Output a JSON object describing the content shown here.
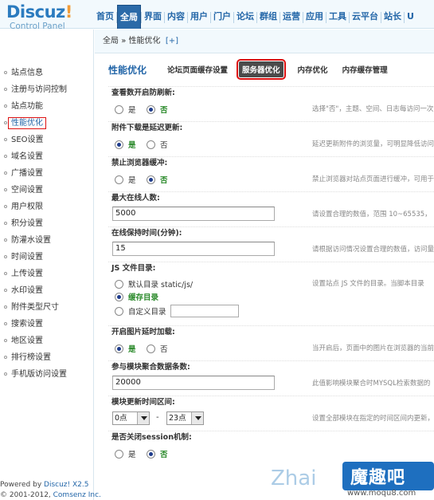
{
  "logo": {
    "main": "Discuz",
    "bang": "!",
    "sub": "Control Panel"
  },
  "topnav": [
    "首页",
    "全局",
    "界面",
    "内容",
    "用户",
    "门户",
    "论坛",
    "群组",
    "运营",
    "应用",
    "工具",
    "云平台",
    "站长",
    "U"
  ],
  "topnav_active": 1,
  "breadcrumb": {
    "section": "全局",
    "sep": "»",
    "page": "性能优化",
    "add": "[+]"
  },
  "sidebar": {
    "items": [
      "站点信息",
      "注册与访问控制",
      "站点功能",
      "性能优化",
      "SEO设置",
      "域名设置",
      "广播设置",
      "空间设置",
      "用户权限",
      "积分设置",
      "防灌水设置",
      "时间设置",
      "上传设置",
      "水印设置",
      "附件类型尺寸",
      "搜索设置",
      "地区设置",
      "排行榜设置",
      "手机版访问设置"
    ],
    "active_index": 3,
    "footer_line1_prefix": "Powered by ",
    "footer_line1_brand": "Discuz! X2.5",
    "footer_line2_prefix": "© 2001-2012, ",
    "footer_line2_brand": "Comsenz Inc."
  },
  "subnav": {
    "title": "性能优化",
    "tabs": [
      "论坛页面缓存设置",
      "服务器优化",
      "内存优化",
      "内存缓存管理"
    ],
    "active_index": 1
  },
  "form": {
    "r1": {
      "title": "查看数开启防刷新:",
      "yes": "是",
      "no": "否",
      "selected": "no",
      "tip": "选择\"否\"，主题、空间、日志每访问一次"
    },
    "r2": {
      "title": "附件下载是延迟更新:",
      "yes": "是",
      "no": "否",
      "selected": "yes",
      "tip": "延迟更新附件的浏览量，可明显降低访问"
    },
    "r3": {
      "title": "禁止浏览器缓冲:",
      "yes": "是",
      "no": "否",
      "selected": "no",
      "tip": "禁止浏览器对站点页面进行缓冲，可用于"
    },
    "r4": {
      "title": "最大在线人数:",
      "value": "5000",
      "tip": "请设置合理的数值，范围 10~65535，"
    },
    "r5": {
      "title": "在线保持时间(分钟):",
      "value": "15",
      "tip": "请根据访问情况设置合理的数值，访问量"
    },
    "r6": {
      "title": "JS 文件目录:",
      "opt1": "默认目录 static/js/",
      "opt2": "缓存目录",
      "opt3": "自定义目录",
      "selected": "opt2",
      "tip": "设置站点 JS 文件的目录。当脚本目录"
    },
    "r7": {
      "title": "开启图片延时加载:",
      "yes": "是",
      "no": "否",
      "selected": "yes",
      "tip": "当开启后，页面中的图片在浏览器的当前"
    },
    "r8": {
      "title": "参与模块聚合数据条数:",
      "value": "20000",
      "tip": "此值影响模块聚合时MYSQL检索数据的"
    },
    "r9": {
      "title": "模块更新时间区间:",
      "from": "0点",
      "dash": "-",
      "to": "23点",
      "tip": "设置全部模块在指定的时间区间内更新，"
    },
    "r10": {
      "title": "是否关闭session机制:",
      "yes": "是",
      "no": "否",
      "selected": "no"
    }
  },
  "watermark": {
    "zhai": "Zhai",
    "name": "魔趣吧",
    "url": "www.moqu8.com"
  },
  "colors": {
    "accent": "#2366a8",
    "active_tab": "#2b6aa8",
    "selected_green": "#2b8a2b",
    "highlight_border": "#dd1111"
  }
}
